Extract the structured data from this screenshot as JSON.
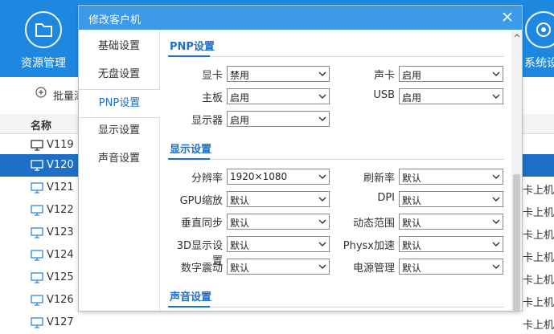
{
  "app": {
    "nav": {
      "resource_label": "资源管理",
      "system_label": "系统设"
    },
    "toolbar": {
      "batch_label": "批量添"
    },
    "list": {
      "header": "名称",
      "rows": [
        {
          "name": "V119",
          "extra": ""
        },
        {
          "name": "V120",
          "extra": ""
        },
        {
          "name": "V121",
          "extra": "卡上机"
        },
        {
          "name": "V122",
          "extra": "卡上机"
        },
        {
          "name": "V123",
          "extra": "卡上机"
        },
        {
          "name": "V124",
          "extra": "卡上机"
        },
        {
          "name": "V125",
          "extra": "卡上机"
        },
        {
          "name": "V126",
          "extra": "卡上机"
        },
        {
          "name": "V127",
          "extra": "卡上机"
        }
      ]
    }
  },
  "dialog": {
    "title": "修改客户机",
    "sidebar": [
      "基础设置",
      "无盘设置",
      "PNP设置",
      "显示设置",
      "声音设置"
    ],
    "sections": {
      "pnp": {
        "title": "PNP设置",
        "fields": {
          "gpu_label": "显卡",
          "gpu_value": "禁用",
          "sound_label": "声卡",
          "sound_value": "启用",
          "board_label": "主板",
          "board_value": "启用",
          "usb_label": "USB",
          "usb_value": "启用",
          "monitor_label": "显示器",
          "monitor_value": "启用"
        }
      },
      "display": {
        "title": "显示设置",
        "fields": {
          "res_label": "分辨率",
          "res_value": "1920×1080",
          "refresh_label": "刷新率",
          "refresh_value": "默认",
          "gpuscale_label": "GPU缩放",
          "gpuscale_value": "默认",
          "dpi_label": "DPI",
          "dpi_value": "默认",
          "vsync_label": "垂直同步",
          "vsync_value": "默认",
          "range_label": "动态范围",
          "range_value": "默认",
          "3d_label": "3D显示设置",
          "3d_value": "默认",
          "physx_label": "Physx加速",
          "physx_value": "默认",
          "vibrance_label": "数字震动",
          "vibrance_value": "默认",
          "power_label": "电源管理",
          "power_value": "默认"
        }
      },
      "sound": {
        "title": "声音设置"
      }
    }
  },
  "colors": {
    "accent": "#1e88e0",
    "title_bar": "#3c9ae8",
    "selection": "#1e6fc6"
  }
}
